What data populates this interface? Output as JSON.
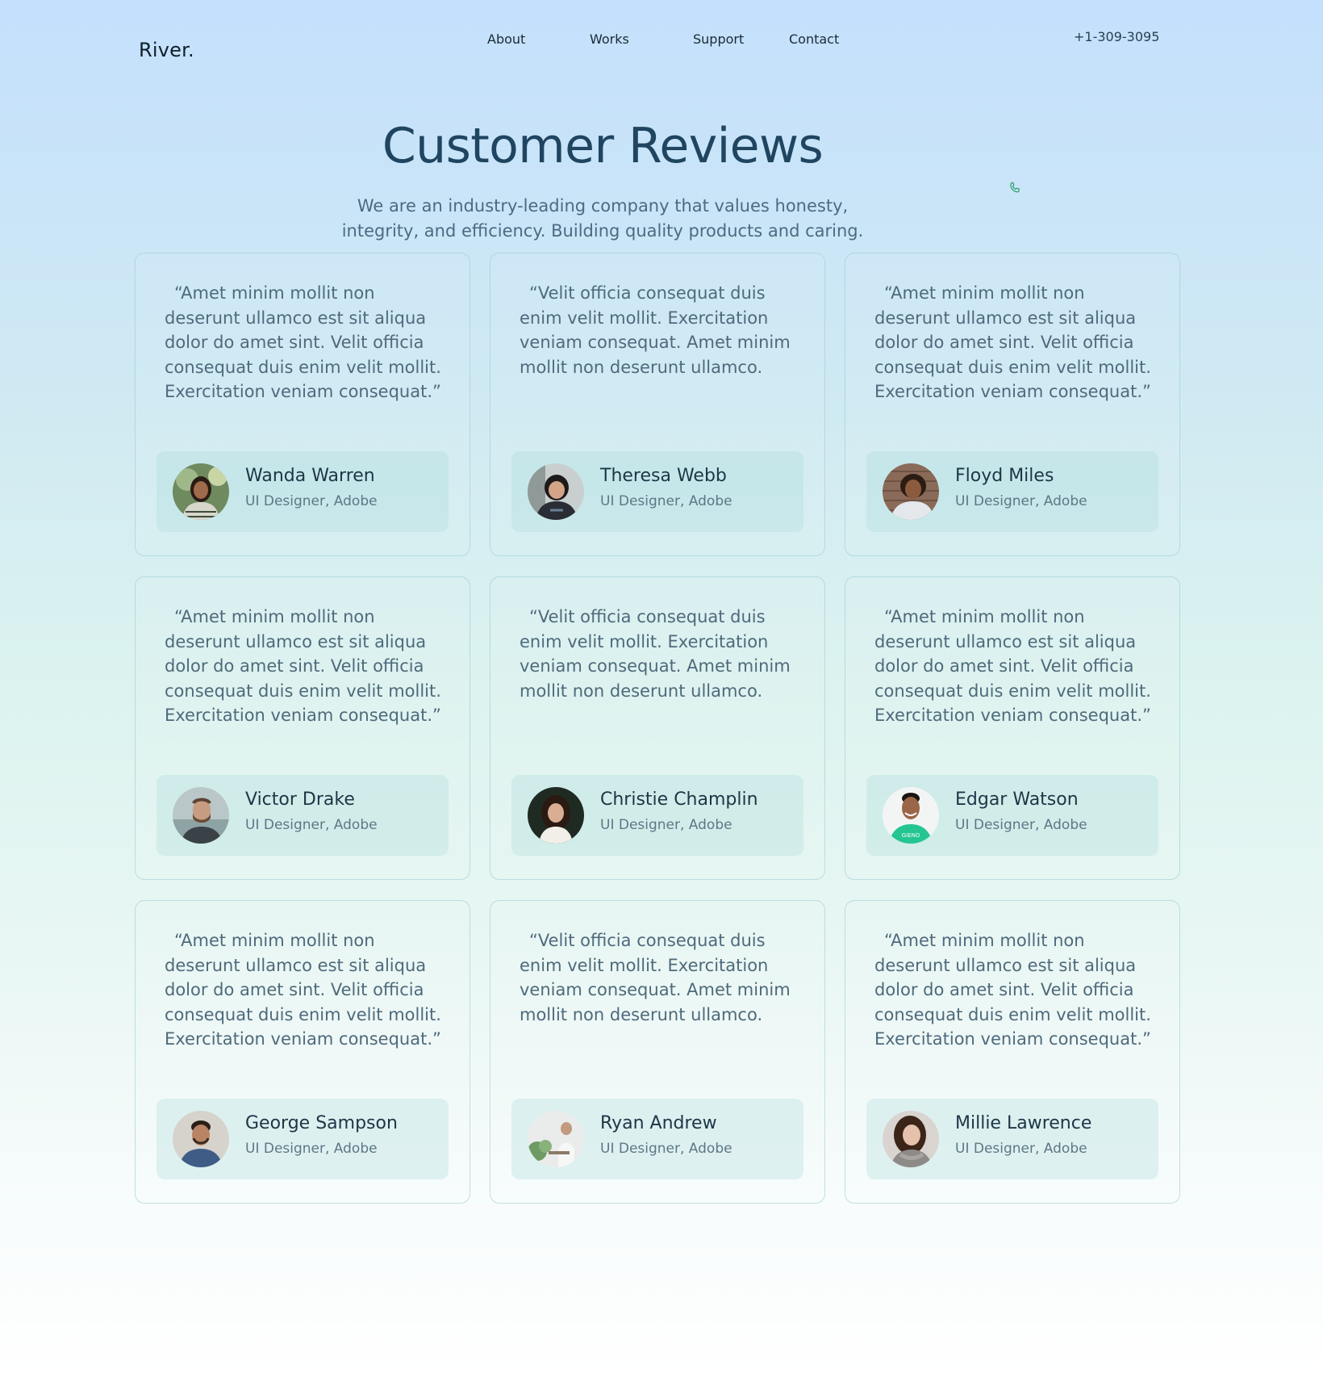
{
  "header": {
    "logo": "River.",
    "nav": [
      "About",
      "Works",
      "Support",
      "Contact"
    ],
    "phone": "+1-309-3095"
  },
  "hero": {
    "title": "Customer Reviews",
    "subtitle": "We are an industry-leading company that values honesty, integrity, and efficiency. Building quality products and caring."
  },
  "reviews": [
    {
      "quote": "“Amet minim mollit non deserunt ullamco est sit aliqua dolor do amet sint. Velit officia consequat duis enim velit mollit. Exercitation veniam consequat.”",
      "name": "Wanda Warren",
      "role": "UI Designer, Adobe"
    },
    {
      "quote": "“Velit officia consequat duis enim velit mollit. Exercitation veniam consequat. Amet minim mollit non deserunt ullamco.",
      "name": "Theresa Webb",
      "role": "UI Designer, Adobe"
    },
    {
      "quote": "“Amet minim mollit non deserunt ullamco est sit aliqua dolor do amet sint. Velit officia consequat duis enim velit mollit. Exercitation veniam consequat.”",
      "name": "Floyd Miles",
      "role": "UI Designer, Adobe"
    },
    {
      "quote": "“Amet minim mollit non deserunt ullamco est sit aliqua dolor do amet sint. Velit officia consequat duis enim velit mollit. Exercitation veniam consequat.”",
      "name": "Victor Drake",
      "role": "UI Designer, Adobe"
    },
    {
      "quote": "“Velit officia consequat duis enim velit mollit. Exercitation veniam consequat. Amet minim mollit non deserunt ullamco.",
      "name": "Christie Champlin",
      "role": "UI Designer, Adobe"
    },
    {
      "quote": "“Amet minim mollit non deserunt ullamco est sit aliqua dolor do amet sint. Velit officia consequat duis enim velit mollit. Exercitation veniam consequat.”",
      "name": "Edgar Watson",
      "role": "UI Designer, Adobe"
    },
    {
      "quote": "“Amet minim mollit non deserunt ullamco est sit aliqua dolor do amet sint. Velit officia consequat duis enim velit mollit. Exercitation veniam consequat.”",
      "name": "George Sampson",
      "role": "UI Designer, Adobe"
    },
    {
      "quote": "“Velit officia consequat duis enim velit mollit. Exercitation veniam consequat. Amet minim mollit non deserunt ullamco.",
      "name": "Ryan Andrew",
      "role": "UI Designer, Adobe"
    },
    {
      "quote": "“Amet minim mollit non deserunt ullamco est sit aliqua dolor do amet sint. Velit officia consequat duis enim velit mollit. Exercitation veniam consequat.”",
      "name": "Millie Lawrence",
      "role": "UI Designer, Adobe"
    }
  ],
  "colors": {
    "accent": "#2a9d6b",
    "title": "#1f4560",
    "body_text": "#4e6a7c"
  },
  "icons": {
    "phone": "phone-icon"
  }
}
